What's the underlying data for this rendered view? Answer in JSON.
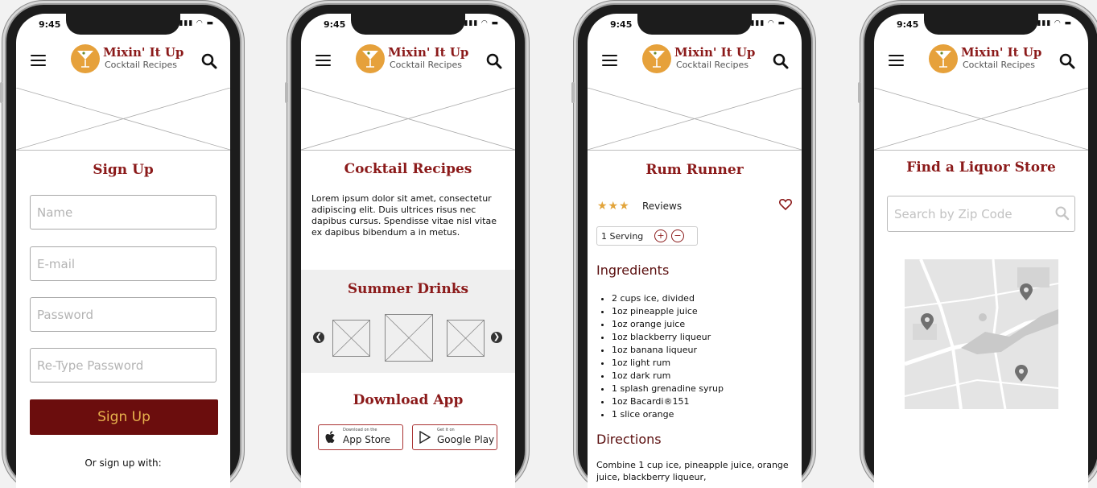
{
  "common": {
    "time": "9:45",
    "status_icons": "▮▮▮ ◠ ▬",
    "logo_title": "Mixin' It Up",
    "logo_subtitle": "Cocktail Recipes"
  },
  "signup": {
    "title": "Sign Up",
    "name_placeholder": "Name",
    "email_placeholder": "E-mail",
    "password_placeholder": "Password",
    "retype_placeholder": "Re-Type Password",
    "button": "Sign Up",
    "or_text": "Or sign up with:"
  },
  "recipes": {
    "title": "Cocktail Recipes",
    "intro": "Lorem ipsum dolor sit amet, consectetur adipiscing elit. Duis ultrices risus nec dapibus cursus.  Spendisse vitae nisl vitae ex dapibus bibendum a in metus.",
    "summer_title": "Summer Drinks",
    "download_title": "Download App",
    "app_store_small": "Download on the",
    "app_store": "App Store",
    "google_play_small": "Get it on",
    "google_play": "Google Play"
  },
  "recipe": {
    "title": "Rum Runner",
    "rating": 3,
    "stars": "★★★",
    "reviews": "Reviews",
    "serving": "1 Serving",
    "plus": "+",
    "minus": "−",
    "ingredients_title": "Ingredients",
    "ingredients": [
      "2 cups ice, divided",
      "1oz pineapple juice",
      "1oz orange juice",
      "1oz blackberry liqueur",
      "1oz banana liqueur",
      "1oz light rum",
      "1oz dark rum",
      "1 splash grenadine syrup",
      "1oz Bacardi®151",
      "1 slice orange"
    ],
    "directions_title": "Directions",
    "directions": "Combine 1 cup ice, pineapple juice, orange juice, blackberry liqueur,"
  },
  "store": {
    "title": "Find a Liquor Store",
    "search_placeholder": "Search by Zip Code"
  },
  "colors": {
    "brand": "#8b1a1a",
    "button": "#6b0d0d",
    "button_text": "#e8b24d",
    "logo_circle": "#e6a13b"
  }
}
